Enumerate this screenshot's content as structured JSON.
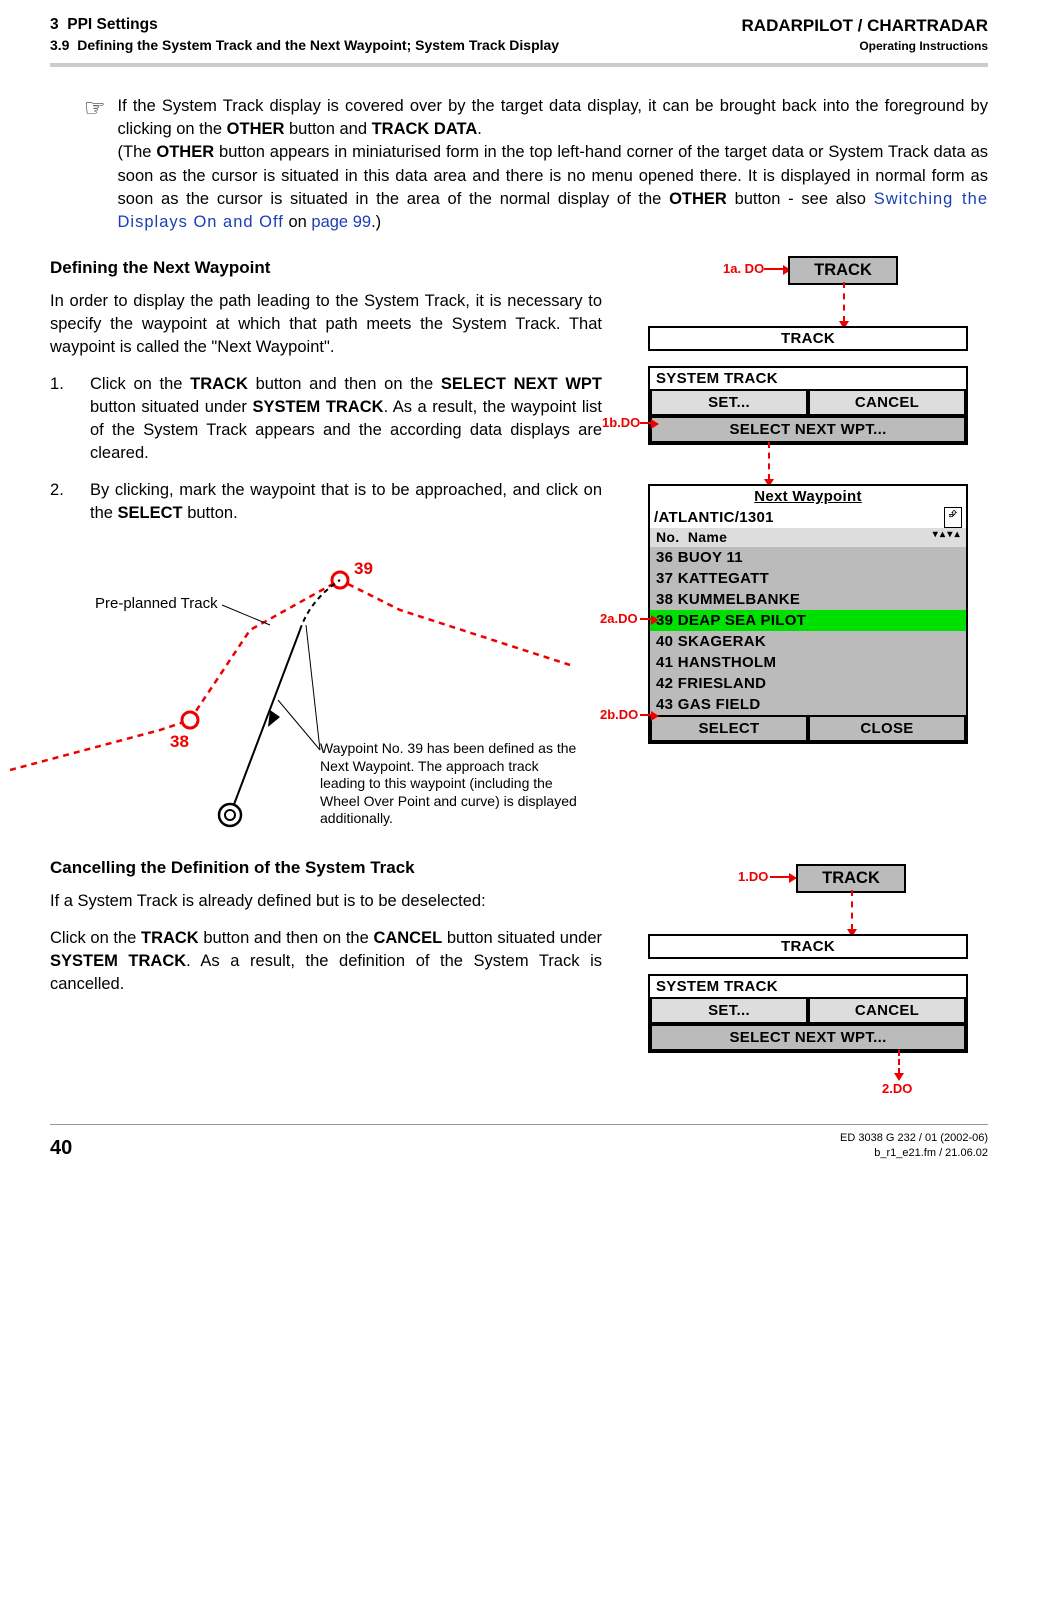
{
  "header": {
    "section_num": "3",
    "section_title": "PPI Settings",
    "subsection": "3.9",
    "subsection_title": "Defining the System Track and the Next Waypoint; System Track Display",
    "product": "RADARPILOT / CHARTRADAR",
    "op_inst": "Operating Instructions"
  },
  "pointer_block": {
    "text1": "If the System Track display is covered over by the target data display, it can be brought back into the foreground by clicking on the ",
    "btn1": "OTHER",
    "text2": " button and ",
    "btn2": "TRACK DATA",
    "text3": ".",
    "text4": "(The ",
    "btn3": "OTHER",
    "text5": " button appears in miniaturised form in the top left-hand corner of the target data or System Track data as soon as the cursor is situated in this data area and there is no menu opened there. It is displayed in normal form as soon as the cursor is situated in the area of the normal display of the ",
    "btn4": "OTHER",
    "text6": " button - see also ",
    "xref": "Switching the Displays On and Off",
    "text7": " on ",
    "xref_page": "page 99",
    "text8": ".)"
  },
  "section1": {
    "heading": "Defining the Next Waypoint",
    "para1": "In order to display the path leading to the System Track, it is necessary to specify the waypoint at which that path meets the System Track. That waypoint is called the \"Next Waypoint\".",
    "step1_a": "Click on the ",
    "step1_b": "TRACK",
    "step1_c": " button and then on the ",
    "step1_d": "SELECT NEXT WPT",
    "step1_e": " button situated under ",
    "step1_f": "SYSTEM TRACK",
    "step1_g": ". As a result, the waypoint list of the System Track appears and the according data displays are cleared.",
    "step2_a": "By clicking, mark the waypoint that is to be approached, and click on the ",
    "step2_b": "SELECT",
    "step2_c": " button."
  },
  "diagram": {
    "label_pre": "Pre-planned Track",
    "wp38": "38",
    "wp39": "39",
    "caption": "Waypoint No. 39 has been defined as the Next Waypoint. The approach track leading to this waypoint (including the Wheel Over Point and curve) is displayed additionally."
  },
  "ui1": {
    "flow_1a": "1a. DO",
    "track_btn": "TRACK",
    "track_title": "TRACK",
    "sys_track": "SYSTEM TRACK",
    "set": "SET...",
    "cancel": "CANCEL",
    "select_next": "SELECT NEXT WPT...",
    "flow_1b": "1b.DO",
    "nwp_title": "Next Waypoint",
    "nwp_path": "/ATLANTIC/1301",
    "col_no": "No.",
    "col_name": "Name",
    "items": [
      "36 BUOY 11",
      "37 KATTEGATT",
      "38 KUMMELBANKE",
      "39 DEAP SEA PILOT",
      "40 SKAGERAK",
      "41 HANSTHOLM",
      "42 FRIESLAND",
      "43 GAS FIELD"
    ],
    "highlight_index": 3,
    "flow_2a": "2a.DO",
    "flow_2b": "2b.DO",
    "select": "SELECT",
    "close": "CLOSE"
  },
  "section2": {
    "heading": "Cancelling the Definition of the System Track",
    "para1": "If a System Track is already defined but is to be deselected:",
    "para2_a": "Click on the ",
    "para2_b": "TRACK",
    "para2_c": " button and then on the ",
    "para2_d": "CANCEL",
    "para2_e": " button situated under ",
    "para2_f": "SYSTEM TRACK",
    "para2_g": ". As a result, the definition of the System Track is cancelled."
  },
  "ui2": {
    "flow_1": "1.DO",
    "track_btn": "TRACK",
    "track_title": "TRACK",
    "sys_track": "SYSTEM TRACK",
    "set": "SET...",
    "cancel": "CANCEL",
    "select_next": "SELECT NEXT WPT...",
    "flow_2": "2.DO"
  },
  "footer": {
    "page": "40",
    "doc_id": "ED 3038 G 232 / 01 (2002-06)",
    "file": "b_r1_e21.fm / 21.06.02"
  }
}
